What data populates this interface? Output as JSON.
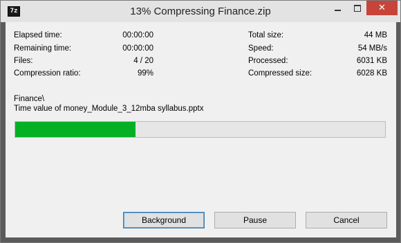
{
  "window": {
    "title": "13% Compressing Finance.zip",
    "app_icon_label": "7z"
  },
  "stats_left": [
    {
      "label": "Elapsed time:",
      "value": "00:00:00"
    },
    {
      "label": "Remaining time:",
      "value": "00:00:00"
    },
    {
      "label": "Files:",
      "value": "4 / 20"
    },
    {
      "label": "Compression ratio:",
      "value": "99%"
    }
  ],
  "stats_right": [
    {
      "label": "Total size:",
      "value": "44 MB"
    },
    {
      "label": "Speed:",
      "value": "54 MB/s"
    },
    {
      "label": "Processed:",
      "value": "6031 KB"
    },
    {
      "label": "Compressed size:",
      "value": "6028 KB"
    }
  ],
  "current": {
    "folder": "Finance\\",
    "file": "Time value of money_Module_3_12mba syllabus.pptx"
  },
  "progress": {
    "fraction": 0.325,
    "bar_color": "#06b025"
  },
  "buttons": {
    "background": "Background",
    "pause": "Pause",
    "cancel": "Cancel"
  }
}
